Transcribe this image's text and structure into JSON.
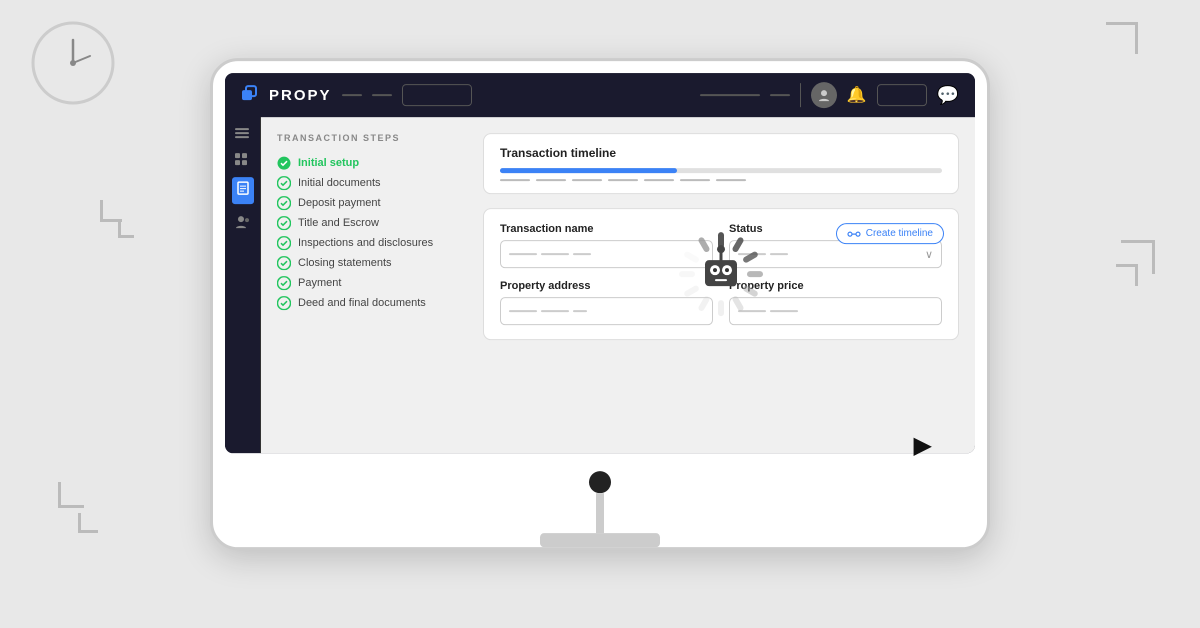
{
  "background": {
    "color": "#e8e8e8"
  },
  "logo": {
    "text": "PROPY",
    "icon_name": "propy-logo-icon"
  },
  "header": {
    "nav_btn_label": "",
    "icons": [
      "user-icon",
      "bell-icon",
      "settings-icon",
      "chat-icon"
    ]
  },
  "sidebar": {
    "icons": [
      "menu-icon",
      "grid-icon",
      "document-icon",
      "people-icon"
    ]
  },
  "transaction_steps": {
    "title": "TRANSACTION STEPS",
    "steps": [
      {
        "label": "Initial setup",
        "active": true,
        "completed": true
      },
      {
        "label": "Initial documents",
        "active": false,
        "completed": true
      },
      {
        "label": "Deposit payment",
        "active": false,
        "completed": true
      },
      {
        "label": "Title and Escrow",
        "active": false,
        "completed": true
      },
      {
        "label": "Inspections and disclosures",
        "active": false,
        "completed": true
      },
      {
        "label": "Closing statements",
        "active": false,
        "completed": true
      },
      {
        "label": "Payment",
        "active": false,
        "completed": true
      },
      {
        "label": "Deed and final documents",
        "active": false,
        "completed": true
      }
    ]
  },
  "timeline_card": {
    "title": "Transaction timeline",
    "progress_percent": 40
  },
  "form": {
    "create_btn_label": "Create timeline",
    "fields": [
      {
        "label": "Transaction name",
        "has_dropdown": false
      },
      {
        "label": "Status",
        "has_dropdown": true
      },
      {
        "label": "Property address",
        "has_dropdown": false
      },
      {
        "label": "Property price",
        "has_dropdown": false
      }
    ]
  },
  "robot": {
    "name": "loading-robot"
  },
  "cursor": {
    "symbol": "▶"
  }
}
